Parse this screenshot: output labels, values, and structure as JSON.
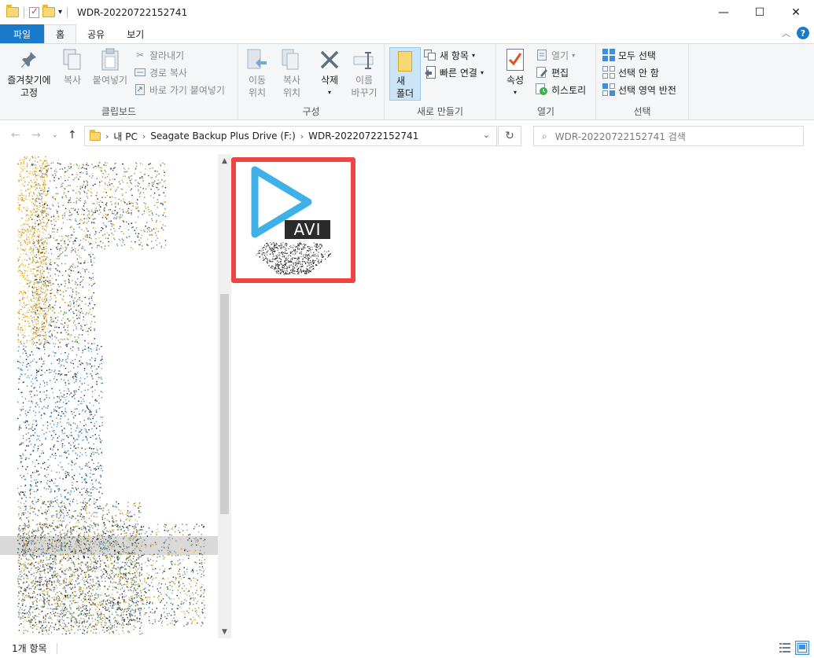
{
  "window": {
    "title": "WDR-20220722152741",
    "controls": {
      "minimize": "—",
      "maximize": "☐",
      "close": "✕"
    }
  },
  "ribbon_tabs": [
    {
      "label": "파일"
    },
    {
      "label": "홈"
    },
    {
      "label": "공유"
    },
    {
      "label": "보기"
    }
  ],
  "ribbon": {
    "clipboard": {
      "label": "클립보드",
      "pin": "즐겨찾기에\n고정",
      "copy": "복사",
      "paste": "붙여넣기",
      "cut": "잘라내기",
      "copy_path": "경로 복사",
      "paste_shortcut": "바로 가기 붙여넣기"
    },
    "organize": {
      "label": "구성",
      "move_to": "이동\n위치",
      "copy_to": "복사\n위치",
      "delete": "삭제",
      "rename": "이름\n바꾸기"
    },
    "new": {
      "label": "새로 만들기",
      "new_folder": "새\n폴더",
      "new_item": "새 항목",
      "easy_access": "빠른 연결"
    },
    "open": {
      "label": "열기",
      "properties": "속성",
      "open": "열기",
      "edit": "편집",
      "history": "히스토리"
    },
    "select": {
      "label": "선택",
      "select_all": "모두 선택",
      "select_none": "선택 안 함",
      "invert": "선택 영역 반전"
    }
  },
  "address": {
    "crumbs": [
      "내 PC",
      "Seagate Backup Plus Drive (F:)",
      "WDR-20220722152741"
    ],
    "search_placeholder": "WDR-20220722152741 검색"
  },
  "files": [
    {
      "type_badge": "AVI",
      "icon": "video-play-icon"
    }
  ],
  "status": {
    "item_count": "1개 항목"
  },
  "colors": {
    "file_tab": "#1979ca",
    "highlight_border": "#ef4444",
    "play_icon": "#3fb1e8"
  }
}
